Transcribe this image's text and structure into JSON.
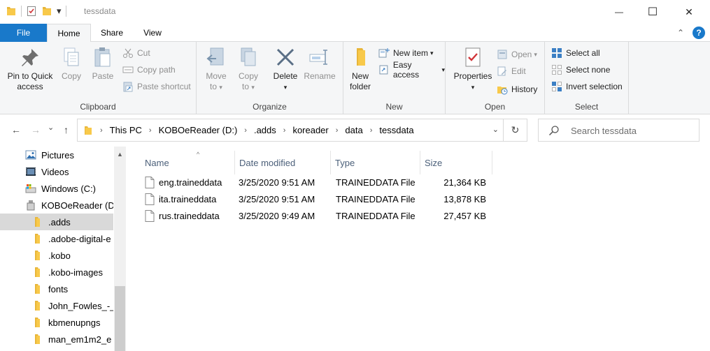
{
  "window": {
    "title": "tessdata",
    "minimize": "—",
    "maximize": "☐",
    "close": "✕"
  },
  "qat": {
    "dropdown": "▾"
  },
  "tabs": {
    "file": "File",
    "home": "Home",
    "share": "Share",
    "view": "View",
    "collapse": "⌃",
    "help": "?"
  },
  "ribbon": {
    "clipboard": {
      "label": "Clipboard",
      "pin_line1": "Pin to Quick",
      "pin_line2": "access",
      "copy": "Copy",
      "paste": "Paste",
      "cut": "Cut",
      "copy_path": "Copy path",
      "paste_shortcut": "Paste shortcut"
    },
    "organize": {
      "label": "Organize",
      "move_line1": "Move",
      "move_line2": "to",
      "copy_line1": "Copy",
      "copy_line2": "to",
      "delete": "Delete",
      "rename": "Rename"
    },
    "new": {
      "label": "New",
      "folder_line1": "New",
      "folder_line2": "folder",
      "new_item": "New item",
      "easy_access": "Easy access"
    },
    "open": {
      "label": "Open",
      "properties": "Properties",
      "open": "Open",
      "edit": "Edit",
      "history": "History"
    },
    "select": {
      "label": "Select",
      "select_all": "Select all",
      "select_none": "Select none",
      "invert": "Invert selection"
    },
    "dropdown_caret": "▾"
  },
  "nav": {
    "back": "←",
    "forward": "→",
    "recent": "⌄",
    "up": "↑"
  },
  "address": {
    "crumbs": [
      "This PC",
      "KOBOeReader (D:)",
      ".adds",
      "koreader",
      "data",
      "tessdata"
    ],
    "chevron": "›",
    "dropdown": "⌄",
    "refresh": "↻"
  },
  "search": {
    "placeholder": "Search tessdata"
  },
  "navpane": {
    "items": [
      {
        "label": "Pictures",
        "icon": "pictures-icon"
      },
      {
        "label": "Videos",
        "icon": "videos-icon"
      },
      {
        "label": "Windows (C:)",
        "icon": "drive-c-icon"
      },
      {
        "label": "KOBOeReader (D:",
        "icon": "usb-drive-icon"
      },
      {
        "label": ".adds",
        "icon": "folder-icon"
      },
      {
        "label": ".adobe-digital-e",
        "icon": "folder-icon"
      },
      {
        "label": ".kobo",
        "icon": "folder-icon"
      },
      {
        "label": ".kobo-images",
        "icon": "folder-icon"
      },
      {
        "label": "fonts",
        "icon": "folder-icon"
      },
      {
        "label": "John_Fowles_-_",
        "icon": "folder-icon"
      },
      {
        "label": "kbmenupngs",
        "icon": "folder-icon"
      },
      {
        "label": "man_em1m2_e",
        "icon": "folder-icon"
      }
    ],
    "selected_index": 4
  },
  "filelist": {
    "columns": [
      "Name",
      "Date modified",
      "Type",
      "Size"
    ],
    "sort_indicator": "^",
    "files": [
      {
        "name": "eng.traineddata",
        "date": "3/25/2020 9:51 AM",
        "type": "TRAINEDDATA File",
        "size": "21,364 KB"
      },
      {
        "name": "ita.traineddata",
        "date": "3/25/2020 9:51 AM",
        "type": "TRAINEDDATA File",
        "size": "13,878 KB"
      },
      {
        "name": "rus.traineddata",
        "date": "3/25/2020 9:49 AM",
        "type": "TRAINEDDATA File",
        "size": "27,457 KB"
      }
    ]
  },
  "colors": {
    "accent": "#1979ca",
    "ribbon_bg": "#f5f6f7",
    "folder_yellow": "#f8c94a",
    "selected_bg": "#d9d9d9",
    "header_text": "#4c607a"
  }
}
